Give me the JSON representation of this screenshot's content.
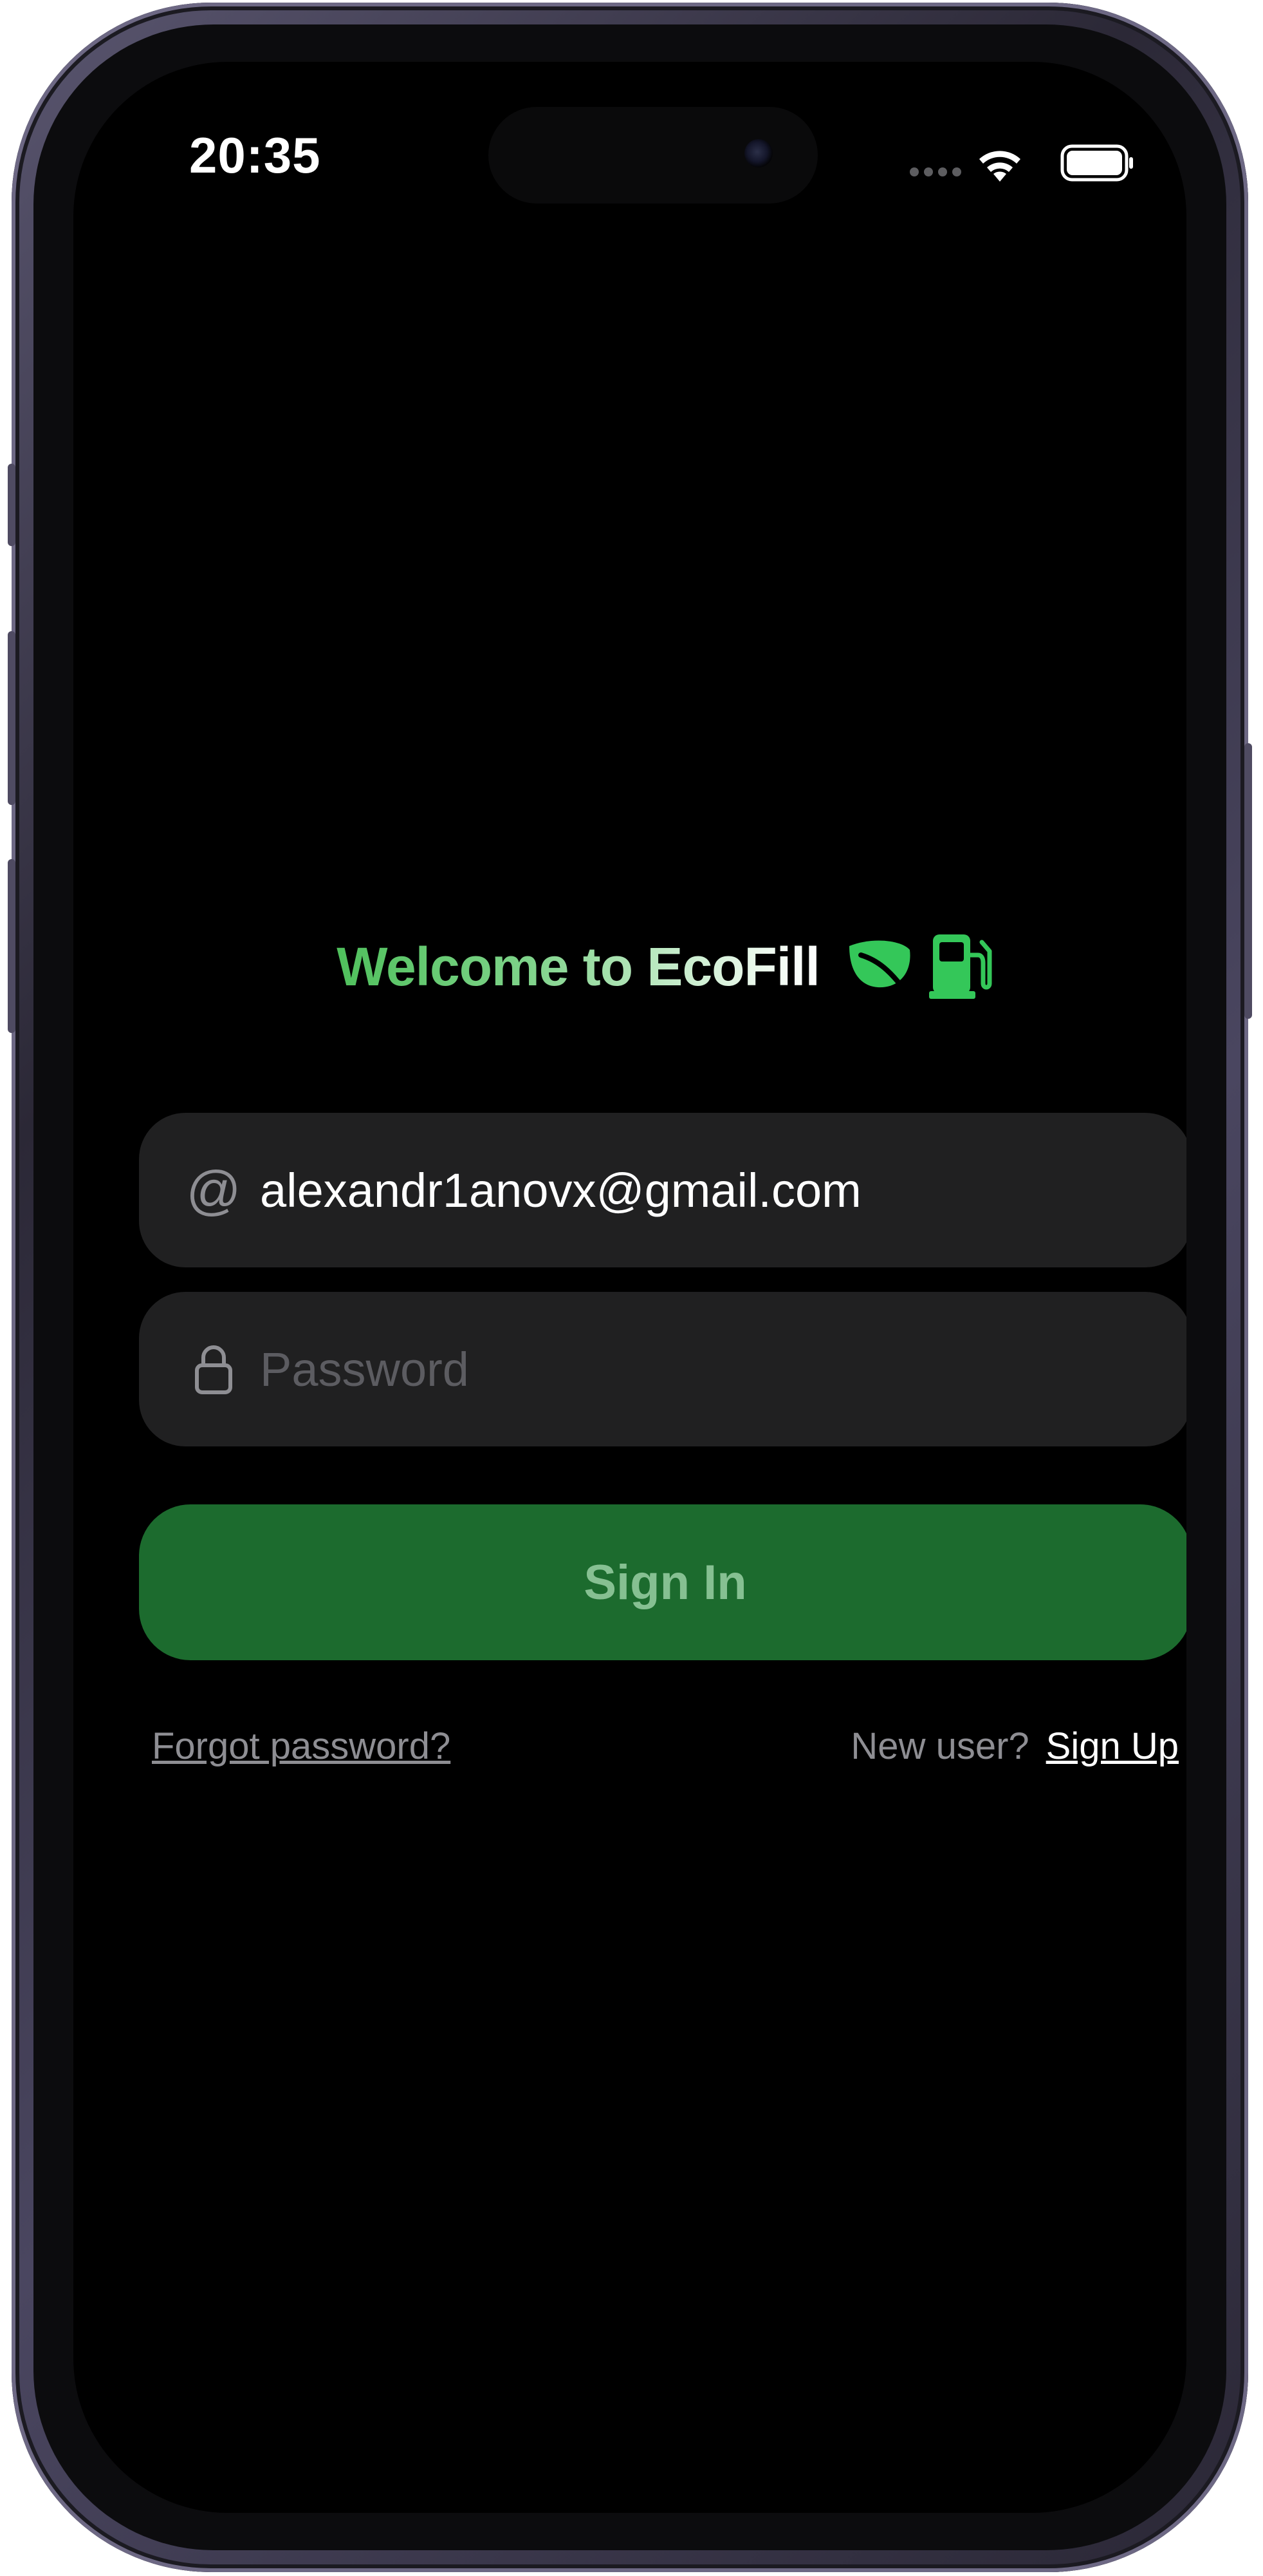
{
  "status_bar": {
    "time": "20:35",
    "wifi_icon": "wifi-icon",
    "battery_icon": "battery-icon"
  },
  "welcome": {
    "title": "Welcome to EcoFill",
    "icons": [
      "leaf-icon",
      "fuel-pump-icon"
    ],
    "title_gradient": [
      "#4fc05c",
      "#ffffff"
    ],
    "icon_color": "#34c759"
  },
  "email_field": {
    "icon": "at-icon",
    "icon_glyph": "@",
    "value": "alexandr1anovx@gmail.com"
  },
  "password_field": {
    "icon": "lock-icon",
    "placeholder": "Password",
    "value": ""
  },
  "sign_in_button": {
    "label": "Sign In",
    "background": "#1c6b2e"
  },
  "footer": {
    "forgot_password": "Forgot password?",
    "new_user": "New user?",
    "sign_up": "Sign Up"
  },
  "colors": {
    "screen_background": "#000000",
    "field_background": "#202021",
    "secondary_text": "#8e8e93"
  }
}
